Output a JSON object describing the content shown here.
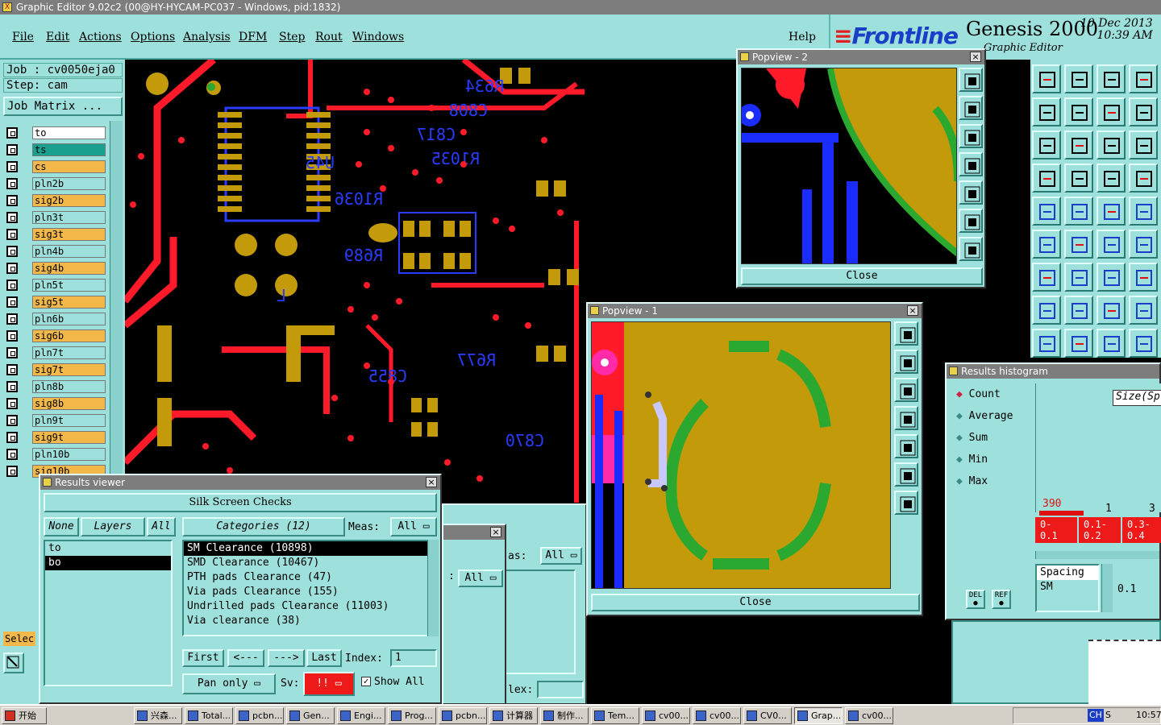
{
  "app": {
    "title": "Graphic Editor 9.02c2 (00@HY-HYCAM-PC037 - Windows, pid:1832)"
  },
  "menu": {
    "items": [
      "File",
      "Edit",
      "Actions",
      "Options",
      "Analysis",
      "DFM",
      "Step",
      "Rout",
      "Windows"
    ],
    "help": "Help"
  },
  "brand": {
    "logo": "Frontline",
    "product": "Genesis 2000",
    "subtitle": "Graphic Editor",
    "date": "10 Dec 2013",
    "time": "10:39 AM"
  },
  "job": {
    "job_line": "Job : cv0050eja0",
    "step_line": "Step: cam",
    "matrix_button": "Job Matrix ..."
  },
  "layers": [
    {
      "name": "to",
      "color": "#ffffff"
    },
    {
      "name": "ts",
      "color": "#1aa08e"
    },
    {
      "name": "cs",
      "color": "#f2b84a"
    },
    {
      "name": "pln2b",
      "color": "#9ee0dc"
    },
    {
      "name": "sig2b",
      "color": "#f2b84a"
    },
    {
      "name": "pln3t",
      "color": "#9ee0dc"
    },
    {
      "name": "sig3t",
      "color": "#f2b84a"
    },
    {
      "name": "pln4b",
      "color": "#9ee0dc"
    },
    {
      "name": "sig4b",
      "color": "#f2b84a"
    },
    {
      "name": "pln5t",
      "color": "#9ee0dc"
    },
    {
      "name": "sig5t",
      "color": "#f2b84a"
    },
    {
      "name": "pln6b",
      "color": "#9ee0dc"
    },
    {
      "name": "sig6b",
      "color": "#f2b84a"
    },
    {
      "name": "pln7t",
      "color": "#9ee0dc"
    },
    {
      "name": "sig7t",
      "color": "#f2b84a"
    },
    {
      "name": "pln8b",
      "color": "#9ee0dc"
    },
    {
      "name": "sig8b",
      "color": "#f2b84a"
    },
    {
      "name": "pln9t",
      "color": "#9ee0dc"
    },
    {
      "name": "sig9t",
      "color": "#f2b84a"
    },
    {
      "name": "pln10b",
      "color": "#9ee0dc"
    },
    {
      "name": "sig10b",
      "color": "#f2b84a"
    }
  ],
  "left_bottom": {
    "select_label": "Selec"
  },
  "popview2": {
    "title": "Popview - 2",
    "close": "Close"
  },
  "popview1": {
    "title": "Popview - 1",
    "close": "Close"
  },
  "results_viewer": {
    "title": "Results viewer",
    "heading": "Silk Screen Checks",
    "none_btn": "None",
    "layers_btn": "Layers",
    "all_btn": "All",
    "categories_btn": "Categories (12)",
    "meas_label": "Meas:",
    "meas_value": "All",
    "layer_list": [
      "to",
      "bo"
    ],
    "category_list": [
      "SM Clearance (10898)",
      "SMD Clearance (10467)",
      "PTH pads Clearance (47)",
      "Via pads Clearance (155)",
      "Undrilled pads Clearance (11003)",
      "Via clearance (38)"
    ],
    "first_btn": "First",
    "prev_btn": "<---",
    "next_btn": "--->",
    "last_btn": "Last",
    "index_label": "Index:",
    "index_value": "1",
    "pan_btn": "Pan only",
    "sv_label": "Sv:",
    "sv_value": "!!",
    "show_all_label": "Show All"
  },
  "behind_window": {
    "as_label": "as:",
    "all_1": "All",
    "all_2": "All",
    "lex_label": "lex:"
  },
  "histogram": {
    "title": "Results histogram",
    "options": [
      "Count",
      "Average",
      "Sum",
      "Min",
      "Max"
    ],
    "selected": "Count",
    "size_label": "Size(Sp",
    "bar_counts": [
      "390",
      "1",
      "3"
    ],
    "bins": [
      "0-\n0.1",
      "0.1-\n0.2",
      "0.3-\n0.4"
    ],
    "del_btn": "DEL",
    "ref_btn": "REF",
    "spacing_label": "Spacing",
    "sm_label": "SM",
    "value": "0.1"
  },
  "taskbar": {
    "start": "开始",
    "tasks": [
      "兴森...",
      "Total...",
      "pcbn...",
      "Gen...",
      "Engi...",
      "Prog...",
      "pcbn...",
      "计算器",
      "制作...",
      "Tem...",
      "cv00...",
      "cv00...",
      "CV0...",
      "Grap...",
      "cv00..."
    ],
    "active": "Grap...",
    "tray_lang": "CH",
    "tray_s": "S",
    "clock": "10:57"
  }
}
